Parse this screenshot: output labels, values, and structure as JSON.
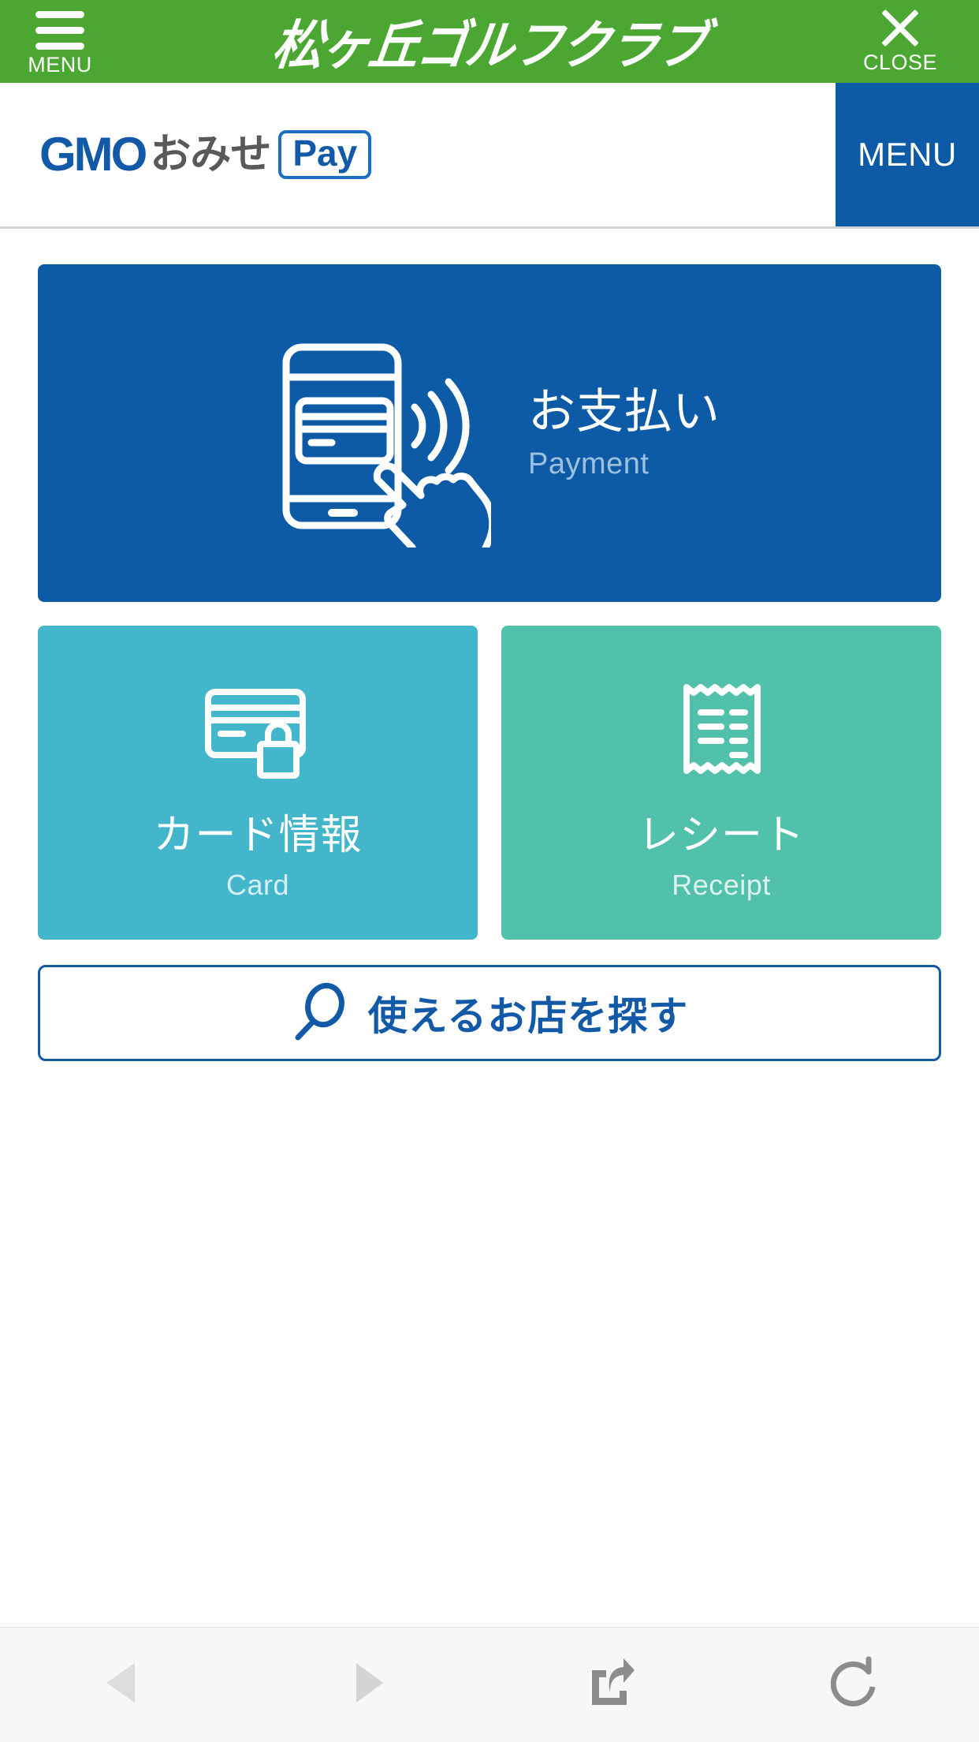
{
  "site_header": {
    "menu_label": "MENU",
    "title": "松ヶ丘ゴルフクラブ",
    "close_label": "CLOSE",
    "background_color": "#4ba732",
    "menu_icon": "hamburger-icon",
    "close_icon": "close-x-icon"
  },
  "app_bar": {
    "logo": {
      "mark": "GMO",
      "omise": "おみせ",
      "pay": "Pay",
      "mark_color": "#1259a8",
      "omise_color": "#58595b",
      "pay_color": "#1259a8"
    },
    "menu_label": "MENU",
    "menu_background": "#0d5ba6"
  },
  "main": {
    "payment_tile": {
      "title": "お支払い",
      "subtitle": "Payment",
      "icon": "smartphone-contactless-payment-icon",
      "background_color": "#0d5ba6"
    },
    "card_tile": {
      "title": "カード情報",
      "subtitle": "Card",
      "icon": "credit-card-lock-icon",
      "background_color": "#44b6cc"
    },
    "receipt_tile": {
      "title": "レシート",
      "subtitle": "Receipt",
      "icon": "receipt-icon",
      "background_color": "#51c1ab"
    },
    "search_button": {
      "label": "使えるお店を探す",
      "icon": "magnifier-icon",
      "border_color": "#1259a8",
      "text_color": "#1259a8"
    }
  },
  "browser_bar": {
    "items": [
      {
        "name": "back",
        "icon": "triangle-left-icon",
        "color": "#dcdcdc"
      },
      {
        "name": "forward",
        "icon": "triangle-right-icon",
        "color": "#d4d4d4"
      },
      {
        "name": "share",
        "icon": "share-icon",
        "color": "#8c8c8c"
      },
      {
        "name": "reload",
        "icon": "reload-icon",
        "color": "#8c8c8c"
      }
    ],
    "background_color": "#f7f7f7"
  }
}
